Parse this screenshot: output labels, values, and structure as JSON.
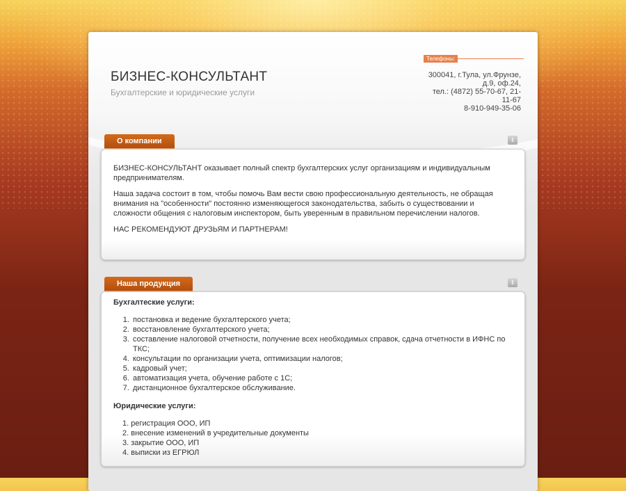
{
  "header": {
    "title": "БИЗНЕС-КОНСУЛЬТАНТ",
    "subtitle": "Бухгалтерские и юридические услуги",
    "phones_label": "Телефоны:",
    "contacts": [
      "300041, г.Тула, ул.Фрунзе,",
      "д.9, оф.24,",
      "тел.: (4872) 55-70-67, 21-",
      "11-67",
      "8-910-949-35-06"
    ]
  },
  "about": {
    "tab_label": "О компании",
    "toggle_icon": "collapse-icon",
    "paragraphs": [
      "БИЗНЕС-КОНСУЛЬТАНТ оказывает полный спектр бухгалтерских услуг организациям и индивидуальным предпринимателям.",
      "Наша задача состоит в том, чтобы помочь Вам вести свою профессиональную деятельность, не обращая внимания на \"особенности\" постоянно изменяющегося законодательства, забыть о существовании и сложности общения с налоговым инспектором, быть уверенным в правильном перечислении налогов.",
      "НАС РЕКОМЕНДУЮТ ДРУЗЬЯМ И ПАРТНЕРАМ!"
    ]
  },
  "products": {
    "tab_label": "Наша продукция",
    "toggle_icon": "collapse-icon",
    "accounting_heading": "Бухгалтеские услуги:",
    "accounting_items": [
      "постановка и ведение бухгалтерского учета;",
      "восстановление бухгалтерского учета;",
      "составление налоговой отчетности, получение всех необходимых справок, сдача отчетности в ИФНС по ТКС;",
      "консультации по организации учета, оптимизации налогов;",
      "кадровый учет;",
      "автоматизация учета, обучение работе с 1С;",
      "дистанционное бухгалтерское обслуживание."
    ],
    "legal_heading": "Юридические услуги:",
    "legal_items": [
      "1. регистрация ООО, ИП",
      "2. внесение изменений в учредительные документы",
      "3. закрытие ООО, ИП",
      "4. выписки из ЕГРЮЛ"
    ]
  },
  "colors": {
    "accent": "#c45a14",
    "phones_tab": "#e8804a",
    "background_dark": "#6a1e12",
    "background_light": "#f6d35a"
  }
}
